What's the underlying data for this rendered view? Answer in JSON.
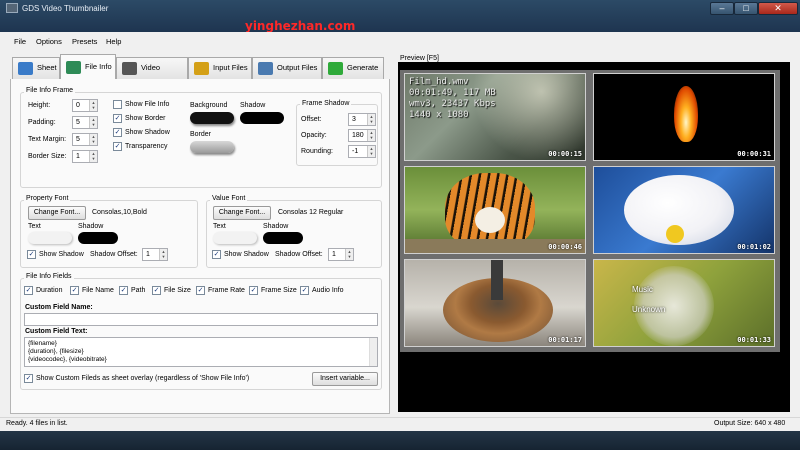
{
  "window": {
    "title": "GDS Video Thumbnailer",
    "minimize": "–",
    "maximize": "□",
    "close": "✕"
  },
  "watermark": "yinghezhan.com",
  "menu": [
    "File",
    "Options",
    "Presets",
    "Help"
  ],
  "tabs": [
    {
      "label": "Sheet",
      "icon": "sheet-icon",
      "color": "#3a7bc8"
    },
    {
      "label": "File Info",
      "icon": "file-info-icon",
      "color": "#2e8b57"
    },
    {
      "label": "Video Frames",
      "icon": "video-frames-icon",
      "color": "#555555"
    },
    {
      "label": "Input Files",
      "icon": "input-files-icon",
      "color": "#d4a017"
    },
    {
      "label": "Output Files",
      "icon": "output-files-icon",
      "color": "#4a7ab0"
    },
    {
      "label": "Generate",
      "icon": "generate-icon",
      "color": "#2faa3a"
    }
  ],
  "file_info_frame": {
    "title": "File Info Frame",
    "height_label": "Height:",
    "height": "0",
    "padding_label": "Padding:",
    "padding": "5",
    "text_margin_label": "Text Margin:",
    "text_margin": "5",
    "border_size_label": "Border Size:",
    "border_size": "1",
    "show_file_info": "Show File Info",
    "show_border": "Show Border",
    "show_shadow": "Show Shadow",
    "transparency": "Transparency",
    "background_label": "Background",
    "shadow_label": "Shadow",
    "border_label": "Border"
  },
  "frame_shadow": {
    "title": "Frame Shadow",
    "offset_label": "Offset:",
    "offset": "3",
    "opacity_label": "Opacity:",
    "opacity": "180",
    "rounding_label": "Rounding:",
    "rounding": "-1"
  },
  "property_font": {
    "title": "Property Font",
    "button": "Change Font...",
    "value": "Consolas,10,Bold",
    "text_label": "Text",
    "shadow_label": "Shadow",
    "show_shadow": "Show Shadow",
    "shadow_offset_label": "Shadow Offset:",
    "shadow_offset": "1"
  },
  "value_font": {
    "title": "Value Font",
    "button": "Change Font...",
    "value": "Consolas 12 Regular",
    "text_label": "Text",
    "shadow_label": "Shadow",
    "show_shadow": "Show Shadow",
    "shadow_offset_label": "Shadow Offset:",
    "shadow_offset": "1"
  },
  "file_info_fields": {
    "title": "File Info Fields",
    "fields": [
      "Duration",
      "File Name",
      "Path",
      "File Size",
      "Frame Rate",
      "Frame Size",
      "Audio Info"
    ],
    "custom_name_label": "Custom Field Name:",
    "custom_text_label": "Custom Field Text:",
    "custom_text_lines": [
      "{filename}",
      "{duration}, {filesize}",
      "{videocodec}, {videobitrate}"
    ],
    "overlay_label": "Show Custom Fileds as sheet overlay (regardless of 'Show File Info')",
    "insert_button": "Insert variable..."
  },
  "preview": {
    "label": "Preview",
    "shortcut": "[F5]",
    "overlay_lines": [
      "Film_hd.wmv",
      "00:01:49, 117 MB",
      "wmv3, 23437 Kbps",
      "1440 x 1080"
    ],
    "thumbnails": [
      {
        "timecode": "00:00:15",
        "name": "forest-thumbnail"
      },
      {
        "timecode": "00:00:31",
        "name": "flame-thumbnail"
      },
      {
        "timecode": "00:00:46",
        "name": "tiger-thumbnail"
      },
      {
        "timecode": "00:01:02",
        "name": "white-flower-thumbnail"
      },
      {
        "timecode": "00:01:17",
        "name": "rusty-metal-thumbnail"
      },
      {
        "timecode": "00:01:33",
        "name": "dandelion-thumbnail"
      }
    ],
    "dandelion_text": [
      "Music",
      "Unknown"
    ]
  },
  "status": {
    "left": "Ready. 4 files in list.",
    "right": "Output Size: 640 x 480"
  }
}
